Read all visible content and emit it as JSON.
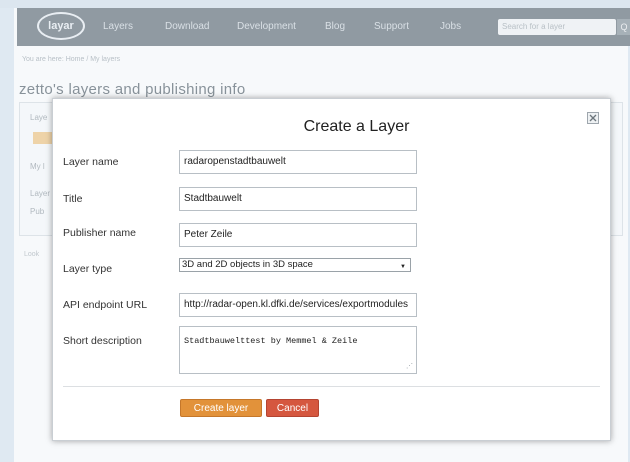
{
  "navbar": {
    "logo_text": "layar",
    "links": [
      "Layers",
      "Download",
      "Development",
      "Blog",
      "Support",
      "Jobs"
    ],
    "search_placeholder": "Search for a layer",
    "search_button": "Q"
  },
  "breadcrumb": "You are here: Home / My layers",
  "background": {
    "heading": "zetto's layers and publishing info",
    "snippet_1": "Laye",
    "snippet_2": "My l",
    "snippet_3": "Layer",
    "snippet_4": "Pub",
    "footer": "Look"
  },
  "dialog": {
    "title": "Create a Layer",
    "fields": {
      "layer_name": {
        "label": "Layer name",
        "value": "radaropenstadtbauwelt"
      },
      "title": {
        "label": "Title",
        "value": "Stadtbauwelt"
      },
      "publisher_name": {
        "label": "Publisher name",
        "value": "Peter Zeile"
      },
      "layer_type": {
        "label": "Layer type",
        "value": "3D and 2D objects in 3D space"
      },
      "api_endpoint": {
        "label": "API endpoint URL",
        "value": "http://radar-open.kl.dfki.de/services/exportmodules"
      },
      "short_description": {
        "label": "Short description",
        "value": "Stadtbauwelttest by Memmel & Zeile"
      }
    },
    "buttons": {
      "create": "Create layer",
      "cancel": "Cancel"
    }
  },
  "colors": {
    "navbar": "#5a6670",
    "create_button": "#e2923a",
    "cancel_button": "#d5573f"
  },
  "icons": {
    "close": "close-icon",
    "dropdown": "chevron-down-icon"
  }
}
